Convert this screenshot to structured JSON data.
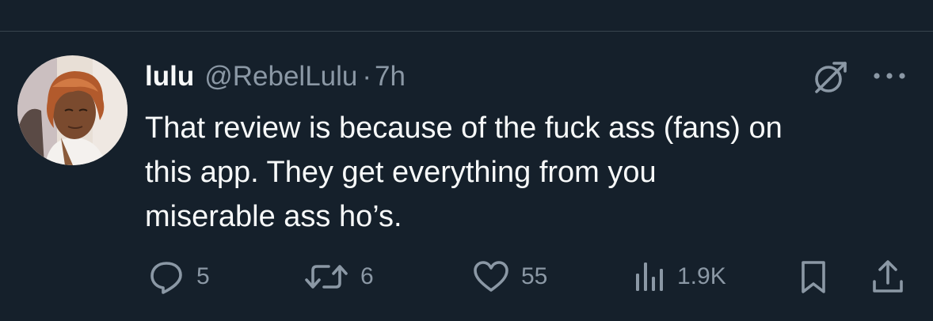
{
  "author": {
    "display_name": "lulu",
    "handle": "@RebelLulu",
    "separator": "·",
    "time": "7h"
  },
  "tweet": {
    "lines": [
      "That review is because of the fuck ass (fans) on",
      "this app. They get everything from you",
      "miserable ass ho’s."
    ]
  },
  "actions": {
    "replies": "5",
    "retweets": "6",
    "likes": "55",
    "views": "1.9K"
  },
  "icons": {
    "grok": "grok-icon",
    "more": "more-icon",
    "reply": "reply-icon",
    "retweet": "retweet-icon",
    "like": "heart-icon",
    "views": "views-icon",
    "bookmark": "bookmark-icon",
    "share": "share-icon"
  },
  "colors": {
    "background": "#15202b",
    "text": "#f7f9f9",
    "secondary": "#8b98a5",
    "divider": "#38444d"
  }
}
